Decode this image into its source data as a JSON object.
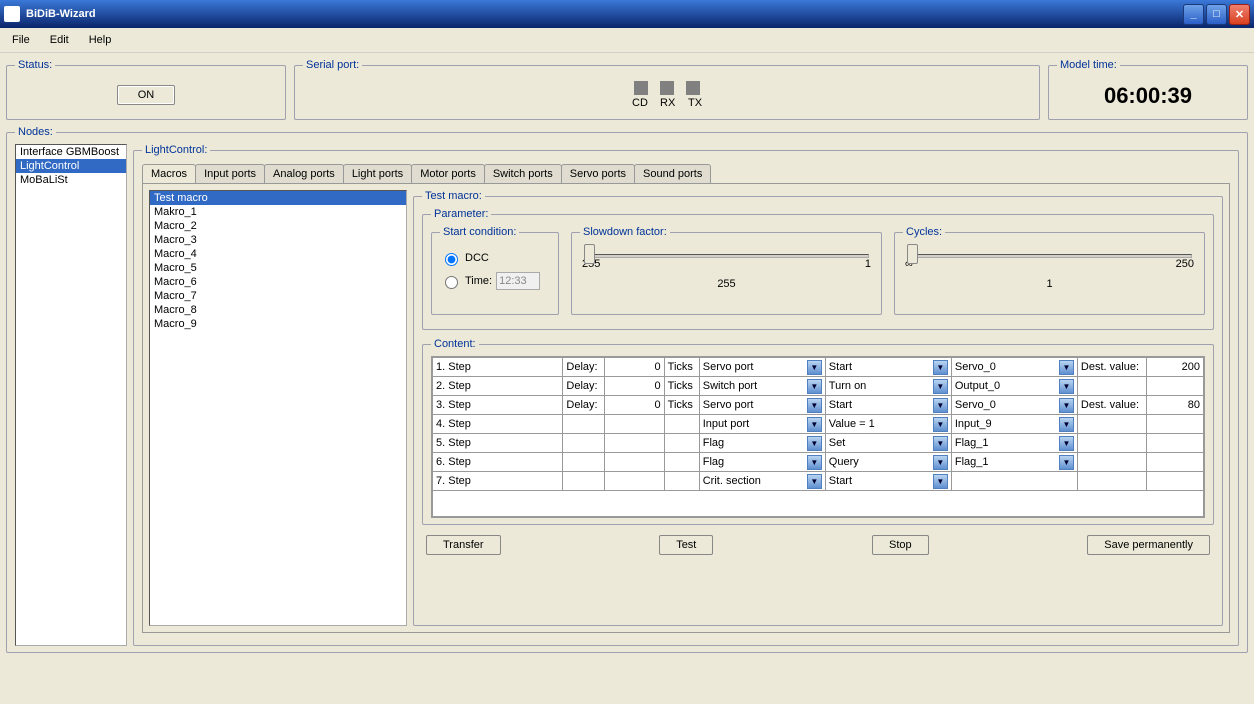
{
  "window": {
    "title": "BiDiB-Wizard"
  },
  "menus": [
    "File",
    "Edit",
    "Help"
  ],
  "status": {
    "legend": "Status:",
    "on_label": "ON"
  },
  "serial": {
    "legend": "Serial port:",
    "cd": "CD",
    "rx": "RX",
    "tx": "TX"
  },
  "model": {
    "legend": "Model time:",
    "time": "06:00:39"
  },
  "nodes": {
    "legend": "Nodes:",
    "items": [
      "Interface GBMBoost",
      "LightControl",
      "MoBaLiSt"
    ],
    "selected": 1
  },
  "lightcontrol": {
    "legend": "LightControl:",
    "tabs": [
      "Macros",
      "Input ports",
      "Analog ports",
      "Light ports",
      "Motor ports",
      "Switch ports",
      "Servo ports",
      "Sound ports"
    ],
    "active_tab": 0,
    "macro_list": [
      "Test macro",
      "Makro_1",
      "Macro_2",
      "Macro_3",
      "Macro_4",
      "Macro_5",
      "Macro_6",
      "Macro_7",
      "Macro_8",
      "Macro_9"
    ],
    "selected_macro": 0,
    "macro_title": "Test macro:",
    "param_legend": "Parameter:",
    "start": {
      "legend": "Start condition:",
      "dcc": "DCC",
      "time": "Time:",
      "time_val": "12:33"
    },
    "slowdown": {
      "legend": "Slowdown factor:",
      "min": "255",
      "max": "1",
      "center": "255"
    },
    "cycles": {
      "legend": "Cycles:",
      "min": "∞",
      "max": "250",
      "center": "1"
    },
    "content": {
      "legend": "Content:",
      "rows": [
        {
          "step": "1. Step",
          "delay_lbl": "Delay:",
          "delay": "0",
          "ticks": "Ticks",
          "port": "Servo port",
          "action": "Start",
          "target": "Servo_0",
          "dest_lbl": "Dest. value:",
          "dest": "200"
        },
        {
          "step": "2. Step",
          "delay_lbl": "Delay:",
          "delay": "0",
          "ticks": "Ticks",
          "port": "Switch port",
          "action": "Turn on",
          "target": "Output_0",
          "dest_lbl": "",
          "dest": ""
        },
        {
          "step": "3. Step",
          "delay_lbl": "Delay:",
          "delay": "0",
          "ticks": "Ticks",
          "port": "Servo port",
          "action": "Start",
          "target": "Servo_0",
          "dest_lbl": "Dest. value:",
          "dest": "80"
        },
        {
          "step": "4. Step",
          "delay_lbl": "",
          "delay": "",
          "ticks": "",
          "port": "Input port",
          "action": "Value = 1",
          "target": "Input_9",
          "dest_lbl": "",
          "dest": ""
        },
        {
          "step": "5. Step",
          "delay_lbl": "",
          "delay": "",
          "ticks": "",
          "port": "Flag",
          "action": "Set",
          "target": "Flag_1",
          "dest_lbl": "",
          "dest": ""
        },
        {
          "step": "6. Step",
          "delay_lbl": "",
          "delay": "",
          "ticks": "",
          "port": "Flag",
          "action": "Query",
          "target": "Flag_1",
          "dest_lbl": "",
          "dest": ""
        },
        {
          "step": "7. Step",
          "delay_lbl": "",
          "delay": "",
          "ticks": "",
          "port": "Crit. section",
          "action": "Start",
          "target": "",
          "dest_lbl": "",
          "dest": ""
        }
      ]
    },
    "buttons": {
      "transfer": "Transfer",
      "test": "Test",
      "stop": "Stop",
      "save": "Save permanently"
    }
  }
}
